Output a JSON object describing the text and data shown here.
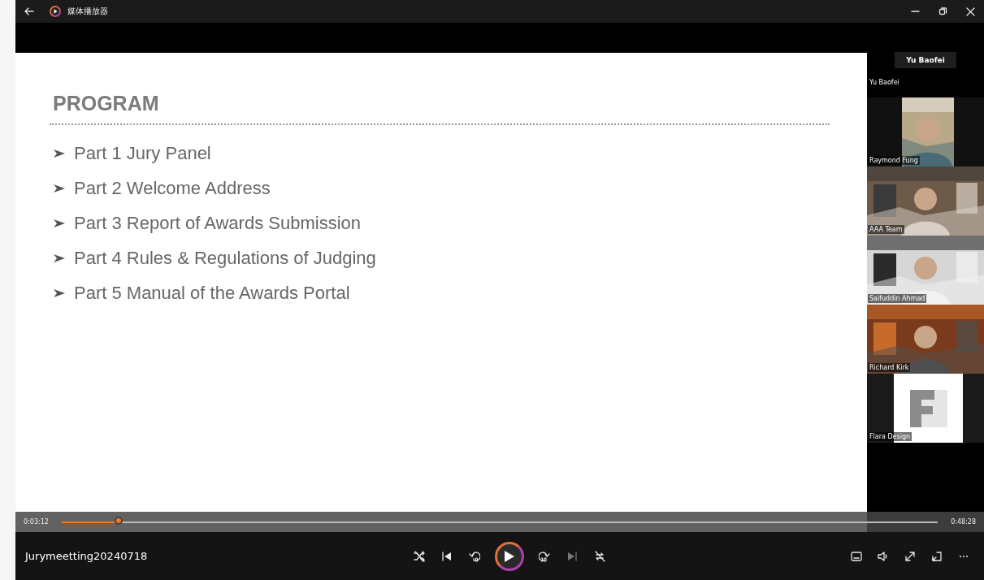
{
  "window": {
    "title": "媒体播放器"
  },
  "slide": {
    "heading": "PROGRAM",
    "items": [
      "Part 1 Jury Panel",
      "Part 2 Welcome Address",
      "Part 3 Report of Awards Submission",
      "Part 4 Rules & Regulations of Judging",
      "Part 5 Manual of the Awards Portal"
    ]
  },
  "participants": {
    "speaker": "Yu Baofei",
    "tiles": [
      {
        "name": "Yu Baofei",
        "kind": "label"
      },
      {
        "name": "Raymond Fung",
        "kind": "inset"
      },
      {
        "name": "AAA Team",
        "kind": "camera"
      },
      {
        "name": "Saifuddin Ahmad",
        "kind": "camera"
      },
      {
        "name": "Richard Kirk",
        "kind": "camera"
      },
      {
        "name": "Flara Design",
        "kind": "logo"
      }
    ]
  },
  "seek": {
    "elapsed": "0:03:12",
    "total": "0:48:28",
    "level": 0.067
  },
  "media_title": "Jurymeetting20240718",
  "controls": [
    {
      "kind": "shuffle",
      "disabled": false
    },
    {
      "kind": "previous",
      "disabled": false
    },
    {
      "kind": "rewind",
      "disabled": false
    },
    {
      "kind": "play",
      "disabled": false
    },
    {
      "kind": "forward",
      "disabled": false
    },
    {
      "kind": "next",
      "disabled": true
    },
    {
      "kind": "repeat",
      "disabled": false
    }
  ],
  "tools": [
    {
      "kind": "subtitles"
    },
    {
      "kind": "volume"
    },
    {
      "kind": "fullscreen"
    },
    {
      "kind": "miniplayer"
    },
    {
      "kind": "more"
    }
  ]
}
